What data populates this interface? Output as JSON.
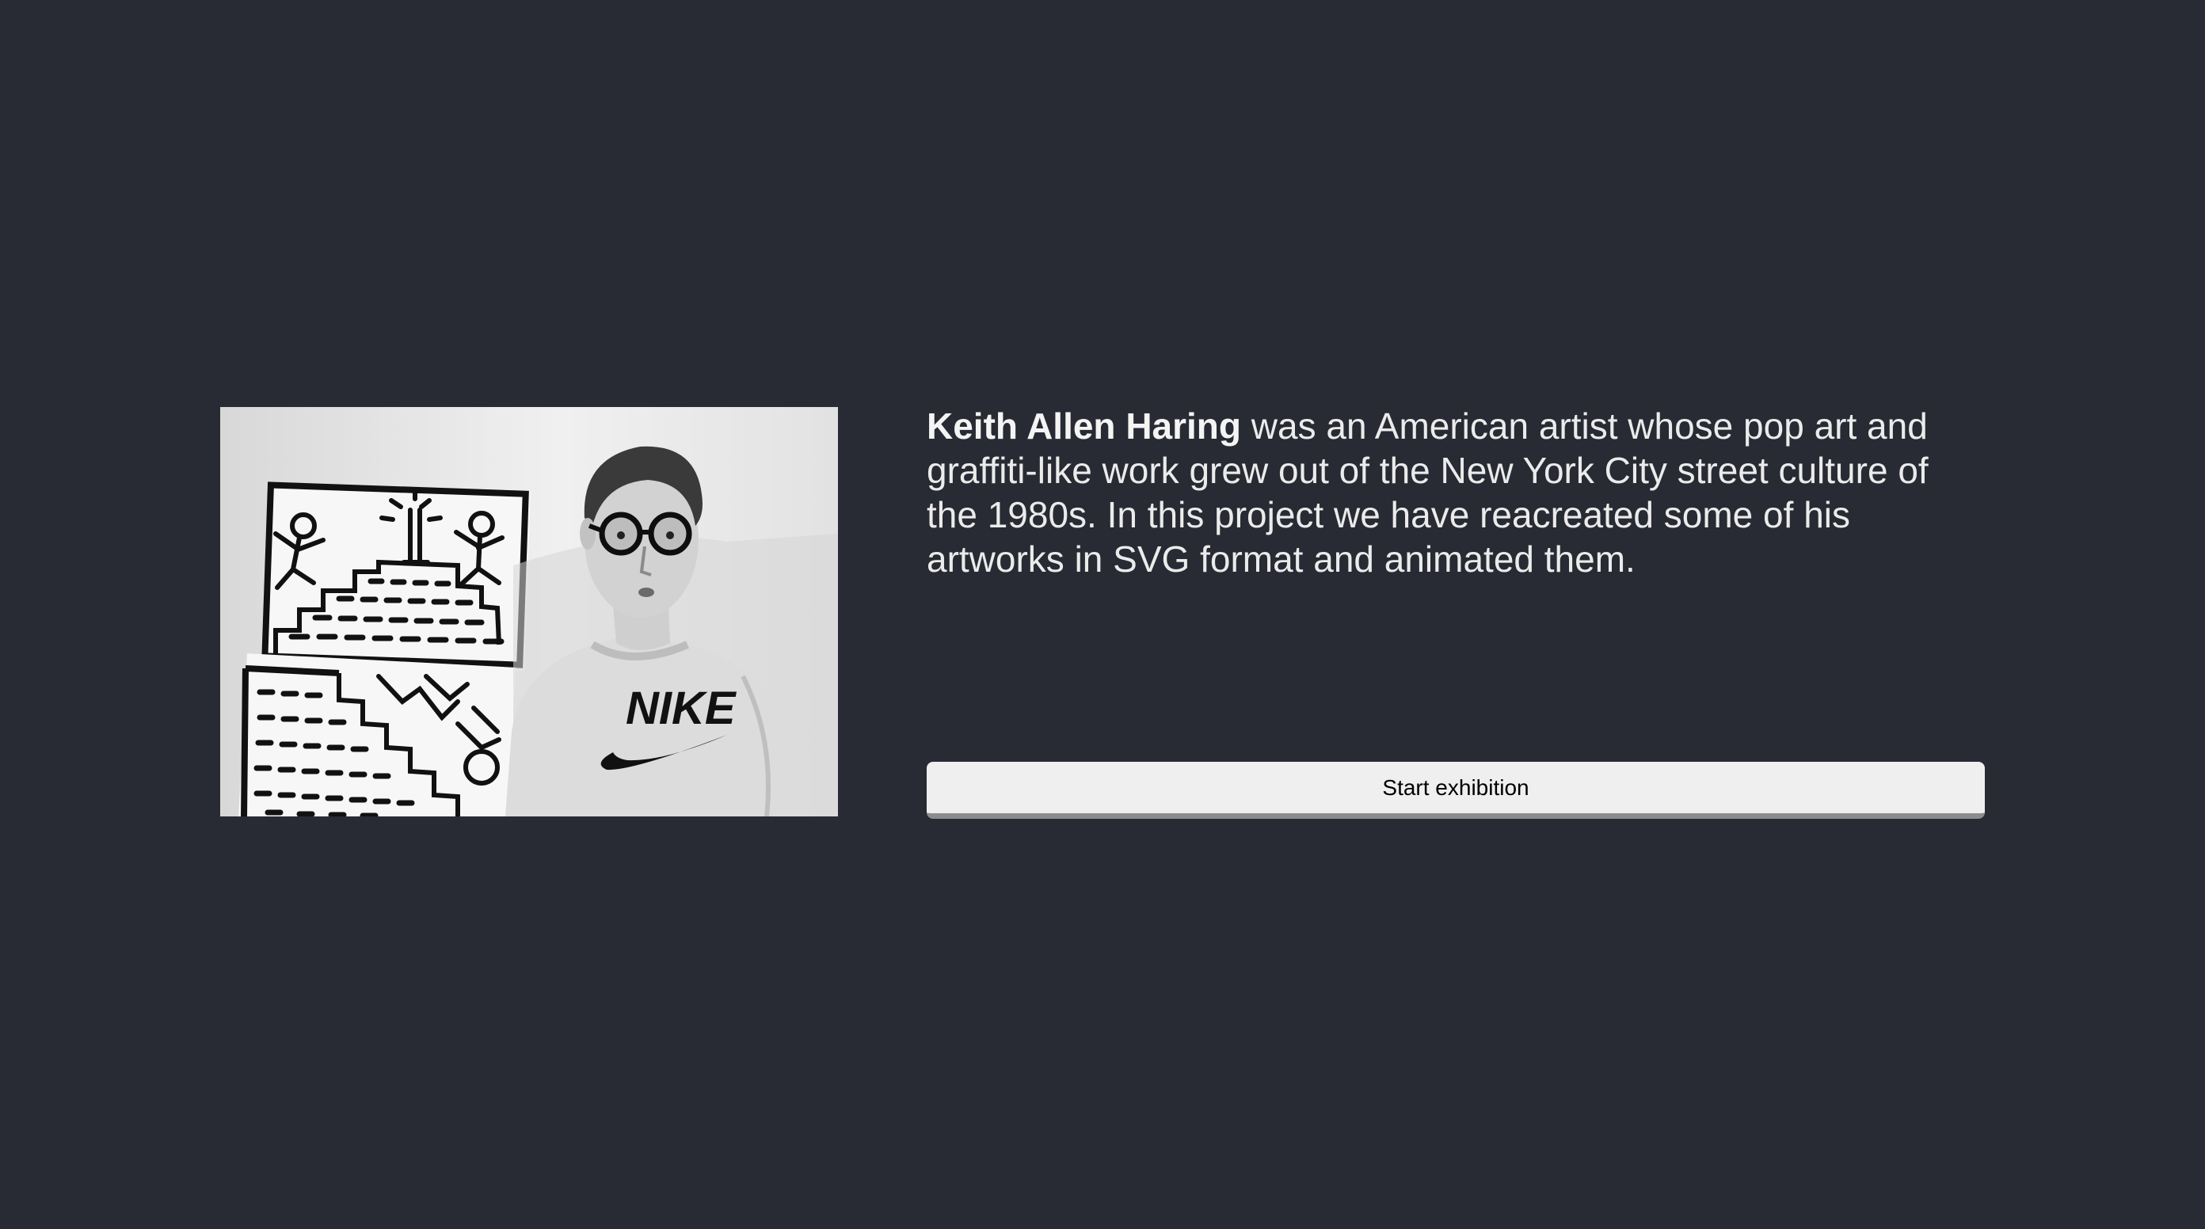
{
  "intro": {
    "name": "Keith Allen Haring",
    "text": " was an American artist whose pop art and graffiti-like work grew out of the New York City street culture of the 1980s. In this project we have reacreated some of his artworks in SVG format and animated them."
  },
  "photo": {
    "shirt_logo": "NIKE",
    "icon": "portrait-photo"
  },
  "start_button": {
    "label": "Start exhibition"
  },
  "colors": {
    "background": "#282b33",
    "text": "#ebebeb",
    "button_background": "#efefef",
    "button_border": "#8c8c90"
  }
}
